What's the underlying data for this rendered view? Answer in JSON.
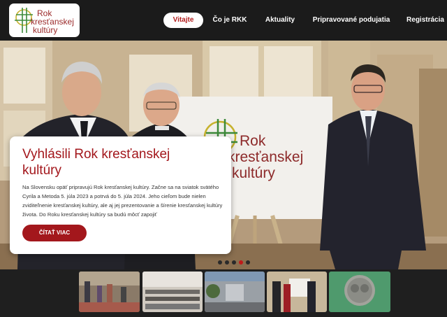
{
  "header": {
    "logo": {
      "line1": "Rok",
      "line2": "kresťanskej",
      "line3": "kultúry",
      "brand_color": "#9b2a2a",
      "icon": "cross-and-sun-logo-icon"
    },
    "nav": [
      {
        "label": "Vitajte",
        "active": true
      },
      {
        "label": "Čo je RKK",
        "active": false
      },
      {
        "label": "Aktuality",
        "active": false
      },
      {
        "label": "Pripravované podujatia",
        "active": false
      },
      {
        "label": "Registrácia",
        "active": false
      }
    ]
  },
  "slide": {
    "title": "Vyhlásili Rok kresťanskej kultúry",
    "text": "Na Slovensku opäť pripravujú Rok kresťanskej kultúry. Začne sa na sviatok svätého Cyrila a Metoda 5. júla 2023 a potrvá do 5. júla 2024. Jeho cieľom bude nielen zviditeľnenie kresťanskej kultúry, ale aj jej prezentovanie a šírenie kresťanskej kultúry života. Do Roku kresťanskej kultúry sa budú môcť zapojiť",
    "button_label": "ČÍTAŤ VIAC",
    "accent_color": "#a3171c",
    "banner_logo": {
      "line1": "Rok",
      "line2": "kresťanskej",
      "line3": "kultúry"
    }
  },
  "slider": {
    "count": 5,
    "active_index": 3
  },
  "thumbnails": [
    {
      "name": "thumb-exhibition-visitors"
    },
    {
      "name": "thumb-conference-hall"
    },
    {
      "name": "thumb-town-street"
    },
    {
      "name": "thumb-announcement"
    },
    {
      "name": "thumb-medal"
    }
  ]
}
